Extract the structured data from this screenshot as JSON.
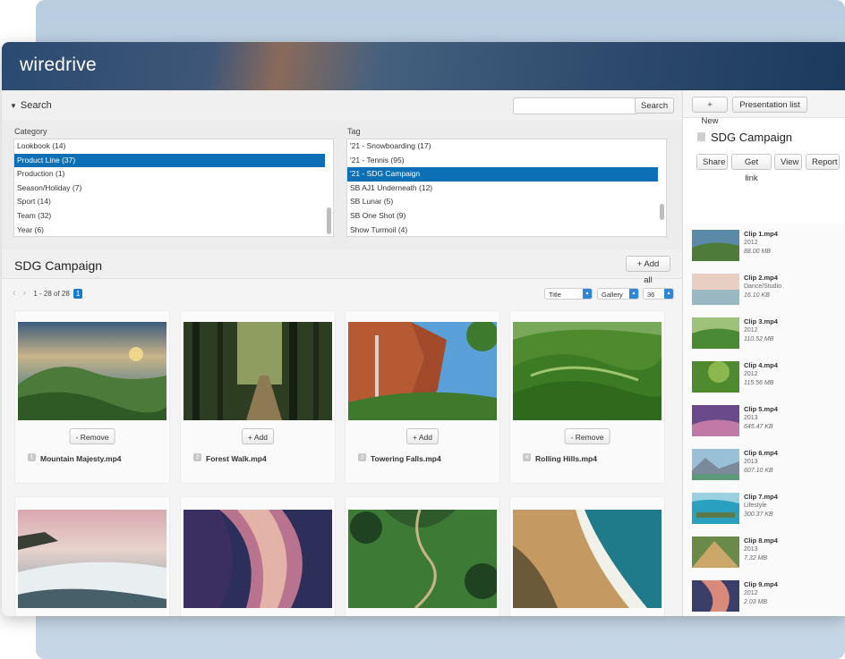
{
  "app": {
    "logo": "wiredrive"
  },
  "search": {
    "toggle_label": "Search",
    "button": "Search",
    "placeholder": ""
  },
  "filters": {
    "category_label": "Category",
    "tag_label": "Tag",
    "categories": [
      "Lookbook (14)",
      "Product Line (37)",
      "Production (1)",
      "Season/Holiday (7)",
      "Sport (14)",
      "Team (32)",
      "Year (6)"
    ],
    "selected_category": "Product Line (37)",
    "tags": [
      "'21 - Snowboarding (17)",
      "'21 - Tennis (95)",
      "'21 - SDG Campaign",
      "SB AJ1 Underneath (12)",
      "SB Lunar (5)",
      "SB One Shot (9)",
      "Show Turmoil (4)"
    ],
    "selected_tag": "'21 - SDG Campaign"
  },
  "collection": {
    "title": "SDG Campaign",
    "add_all": "+ Add all",
    "range": "1 - 28 of 28",
    "page": "1",
    "sort": "Title",
    "view": "Gallery",
    "per_page": "36",
    "items": [
      {
        "index": "1",
        "name": "Mountain Majesty.mp4",
        "action": "- Remove"
      },
      {
        "index": "2",
        "name": "Forest Walk.mp4",
        "action": "+ Add"
      },
      {
        "index": "3",
        "name": "Towering Falls.mp4",
        "action": "+ Add"
      },
      {
        "index": "4",
        "name": "Rolling Hills.mp4",
        "action": "- Remove"
      }
    ]
  },
  "side": {
    "new_button": "+ New",
    "presentation_button": "Presentation list",
    "title": "SDG Campaign",
    "actions": [
      "Share",
      "Get link",
      "View",
      "Report"
    ],
    "clips": [
      {
        "name": "Clip 1.mp4",
        "meta": "2012",
        "size": "88.00 MB"
      },
      {
        "name": "Clip 2.mp4",
        "meta": "Dance/Studio",
        "size": "16.10 KB"
      },
      {
        "name": "Clip 3.mp4",
        "meta": "2012",
        "size": "110.52 MB"
      },
      {
        "name": "Clip 4.mp4",
        "meta": "2012",
        "size": "115.56 MB"
      },
      {
        "name": "Clip 5.mp4",
        "meta": "2013",
        "size": "645.47 KB"
      },
      {
        "name": "Clip 6.mp4",
        "meta": "2013",
        "size": "607.10 KB"
      },
      {
        "name": "Clip 7.mp4",
        "meta": "Lifestyle",
        "size": "300.37 KB"
      },
      {
        "name": "Clip 8.mp4",
        "meta": "2013",
        "size": "7.32 MB"
      },
      {
        "name": "Clip 9.mp4",
        "meta": "2012",
        "size": "2.03 MB"
      }
    ]
  }
}
